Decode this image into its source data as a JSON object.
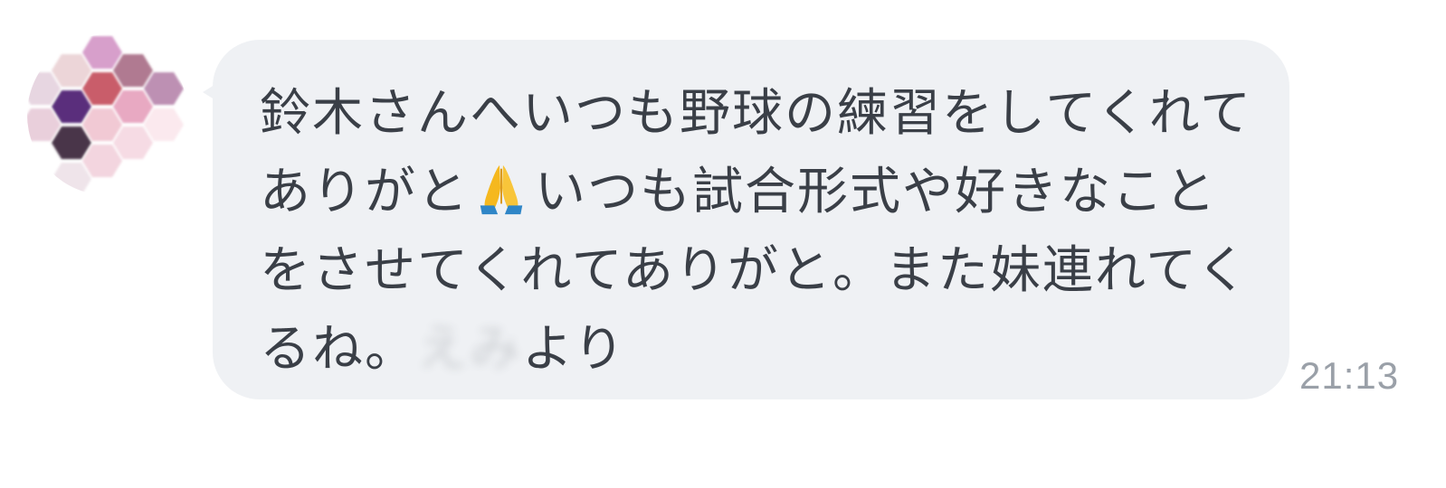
{
  "message": {
    "text_part1": "鈴木さんへいつも野球の練習をしてくれてありがと",
    "emoji": "folded-hands",
    "text_part2": "いつも試合形式や好きなことをさせてくれてありがと。また妹連れてくるね。",
    "blurred_sender": "えみ",
    "text_part3": "より",
    "time": "21:13"
  },
  "avatar": {
    "icon": "blurred-avatar-icon",
    "colors": [
      "#d79fcb",
      "#ecd5d8",
      "#b07a91",
      "#c95d6b",
      "#bd90b3",
      "#5a2d7b",
      "#e8a9c2",
      "#f1c9d4",
      "#4a3548"
    ]
  },
  "colors": {
    "bubble": "#eff1f4",
    "text": "#3a3f47",
    "timestamp": "#9aa0a8",
    "background": "#ffffff"
  }
}
